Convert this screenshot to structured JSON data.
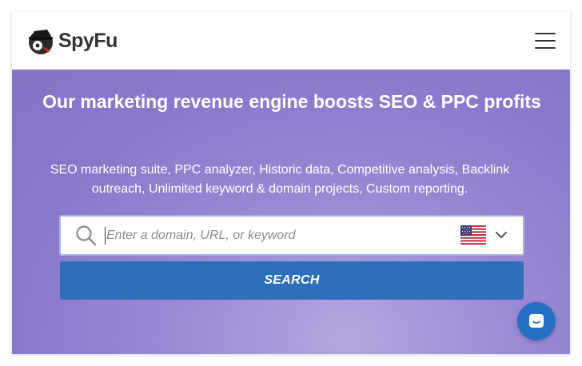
{
  "header": {
    "logo_text": "SpyFu",
    "logo_icon": "spy-hat-logo-icon",
    "menu_icon": "hamburger-menu-icon"
  },
  "hero": {
    "headline": "Our marketing revenue engine boosts SEO & PPC profits",
    "subline": "SEO marketing suite, PPC analyzer, Historic data, Competitive analysis, Backlink outreach, Unlimited keyword & domain projects, Custom reporting."
  },
  "search": {
    "placeholder": "Enter a domain, URL, or keyword",
    "value": "",
    "icon": "search-icon",
    "country_flag": "us-flag-icon",
    "dropdown_icon": "chevron-down-icon",
    "button_label": "SEARCH"
  },
  "chat": {
    "icon": "chat-icon"
  },
  "colors": {
    "hero_purple": "#8a78cb",
    "button_blue": "#2d6fb8",
    "chat_blue": "#2470c2",
    "text_white": "#ffffff"
  }
}
